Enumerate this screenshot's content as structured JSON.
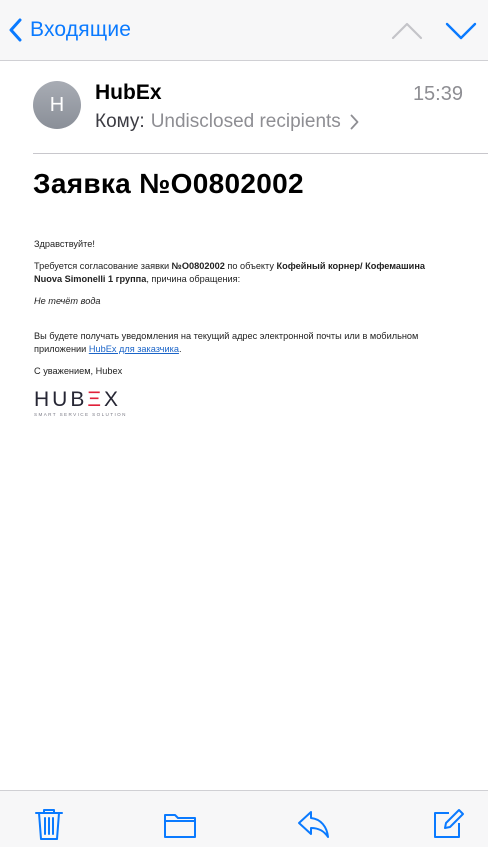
{
  "nav": {
    "back_label": "Входящие",
    "icons": {
      "back": "chevron-left-icon",
      "up": "chevron-up-icon",
      "down": "chevron-down-icon"
    },
    "accent_color": "#0a7aff"
  },
  "message": {
    "avatar_initial": "H",
    "sender": "HubEx",
    "time": "15:39",
    "to_label": "Кому:",
    "to_value": "Undisclosed recipients",
    "subject": "Заявка №О0802002"
  },
  "body": {
    "greeting": "Здравствуйте!",
    "request_prefix": "Требуется согласование заявки ",
    "request_number": "№О0802002",
    "request_mid": " по объекту ",
    "object_name": "Кофейный корнер/ Кофемашина Nuova Simonelli 1 группа",
    "request_suffix": ", причина обращения:",
    "problem": "Не течёт вода",
    "notify_text": "Вы будете получать уведомления на текущий адрес электронной почты или в мобильном приложении ",
    "app_link": "HubEx для заказчика",
    "notify_end": ".",
    "signature": "С уважением, Hubex"
  },
  "logo": {
    "part1": "HUB",
    "part2": "Ξ",
    "part3": "X",
    "tagline": "SMART SERVICE SOLUTION",
    "accent_color": "#e0203a"
  },
  "toolbar": {
    "icons": [
      "trash-icon",
      "folder-icon",
      "reply-icon",
      "compose-icon"
    ]
  }
}
